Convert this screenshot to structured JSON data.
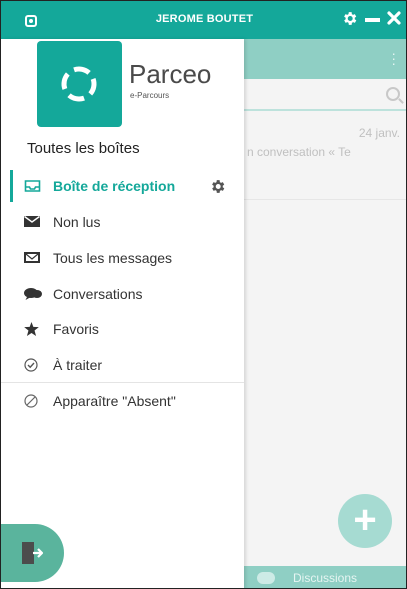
{
  "window": {
    "title": "JEROME BOUTET",
    "controls": {
      "settings_icon": "gear-icon",
      "minimize_icon": "minimize-icon",
      "close_icon": "close-icon"
    }
  },
  "brand": {
    "name": "Parceo",
    "subtitle": "e-Parcours",
    "accent_color": "#14a89a"
  },
  "drawer": {
    "section_title": "Toutes les boîtes",
    "items": [
      {
        "label": "Boîte de réception",
        "icon": "inbox-icon",
        "active": true
      },
      {
        "label": "Non lus",
        "icon": "envelope-icon"
      },
      {
        "label": "Tous les messages",
        "icon": "envelope-open-icon"
      },
      {
        "label": "Conversations",
        "icon": "chat-bubbles-icon"
      },
      {
        "label": "Favoris",
        "icon": "star-icon"
      },
      {
        "label": "À traiter",
        "icon": "check-circle-icon"
      },
      {
        "label": "Apparaître \"Absent\"",
        "icon": "slash-circle-icon"
      }
    ],
    "logout_icon": "logout-icon"
  },
  "background": {
    "date": "24 janv.",
    "snippet": "n conversation « Te",
    "bottom_tab": "Discussions"
  }
}
